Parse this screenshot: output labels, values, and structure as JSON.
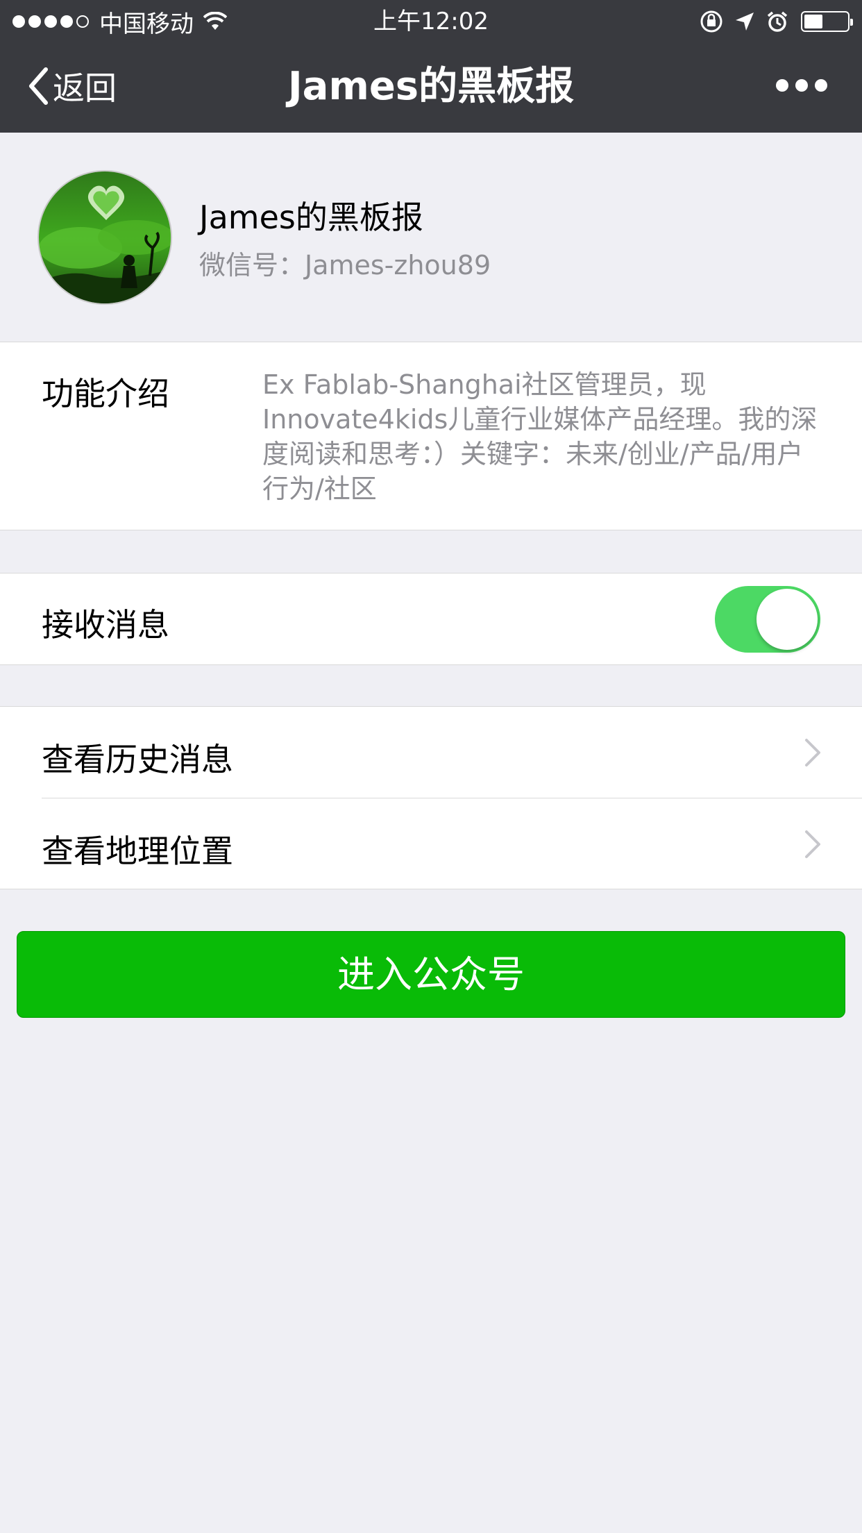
{
  "status_bar": {
    "carrier": "中国移动",
    "time": "上午12:02",
    "signal_bars": 4,
    "signal_total": 5
  },
  "nav": {
    "back_label": "返回",
    "title": "James的黑板报"
  },
  "profile": {
    "name": "James的黑板报",
    "wechat_id": "微信号：James-zhou89"
  },
  "intro": {
    "label": "功能介绍",
    "text": "Ex Fablab-Shanghai社区管理员，现Innovate4kids儿童行业媒体产品经理。我的深度阅读和思考：）关键字：未来/创业/产品/用户行为/社区"
  },
  "receive_messages": {
    "label": "接收消息",
    "enabled": true
  },
  "list": [
    {
      "label": "查看历史消息"
    },
    {
      "label": "查看地理位置"
    }
  ],
  "enter_button": {
    "label": "进入公众号"
  },
  "colors": {
    "nav_bg": "#393a3f",
    "page_bg": "#efeff4",
    "toggle_on": "#4cd964",
    "primary_green": "#09bb07",
    "secondary_text": "#8e8e93"
  }
}
